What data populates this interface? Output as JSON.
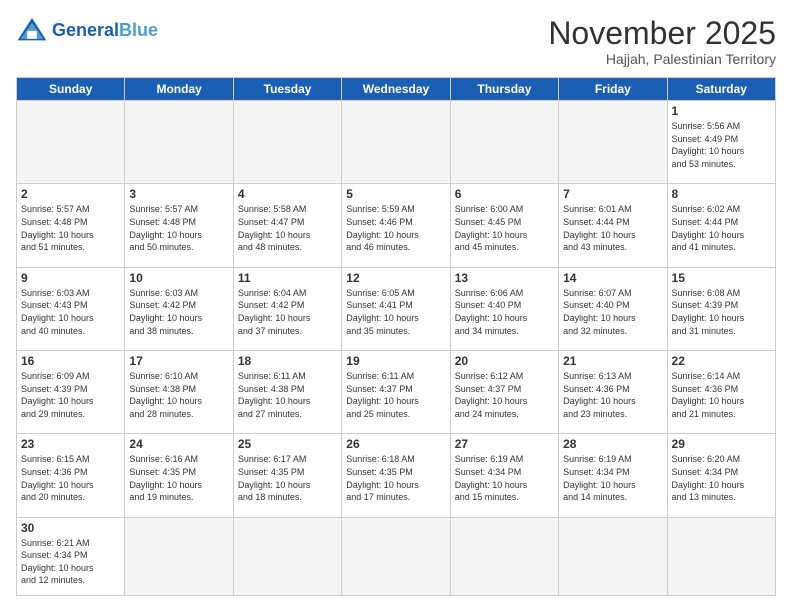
{
  "header": {
    "logo_general": "General",
    "logo_blue": "Blue",
    "month_title": "November 2025",
    "subtitle": "Hajjah, Palestinian Territory"
  },
  "days_of_week": [
    "Sunday",
    "Monday",
    "Tuesday",
    "Wednesday",
    "Thursday",
    "Friday",
    "Saturday"
  ],
  "weeks": [
    [
      {
        "day": "",
        "info": "",
        "empty": true
      },
      {
        "day": "",
        "info": "",
        "empty": true
      },
      {
        "day": "",
        "info": "",
        "empty": true
      },
      {
        "day": "",
        "info": "",
        "empty": true
      },
      {
        "day": "",
        "info": "",
        "empty": true
      },
      {
        "day": "",
        "info": "",
        "empty": true
      },
      {
        "day": "1",
        "info": "Sunrise: 5:56 AM\nSunset: 4:49 PM\nDaylight: 10 hours\nand 53 minutes."
      }
    ],
    [
      {
        "day": "2",
        "info": "Sunrise: 5:57 AM\nSunset: 4:48 PM\nDaylight: 10 hours\nand 51 minutes."
      },
      {
        "day": "3",
        "info": "Sunrise: 5:57 AM\nSunset: 4:48 PM\nDaylight: 10 hours\nand 50 minutes."
      },
      {
        "day": "4",
        "info": "Sunrise: 5:58 AM\nSunset: 4:47 PM\nDaylight: 10 hours\nand 48 minutes."
      },
      {
        "day": "5",
        "info": "Sunrise: 5:59 AM\nSunset: 4:46 PM\nDaylight: 10 hours\nand 46 minutes."
      },
      {
        "day": "6",
        "info": "Sunrise: 6:00 AM\nSunset: 4:45 PM\nDaylight: 10 hours\nand 45 minutes."
      },
      {
        "day": "7",
        "info": "Sunrise: 6:01 AM\nSunset: 4:44 PM\nDaylight: 10 hours\nand 43 minutes."
      },
      {
        "day": "8",
        "info": "Sunrise: 6:02 AM\nSunset: 4:44 PM\nDaylight: 10 hours\nand 41 minutes."
      }
    ],
    [
      {
        "day": "9",
        "info": "Sunrise: 6:03 AM\nSunset: 4:43 PM\nDaylight: 10 hours\nand 40 minutes."
      },
      {
        "day": "10",
        "info": "Sunrise: 6:03 AM\nSunset: 4:42 PM\nDaylight: 10 hours\nand 38 minutes."
      },
      {
        "day": "11",
        "info": "Sunrise: 6:04 AM\nSunset: 4:42 PM\nDaylight: 10 hours\nand 37 minutes."
      },
      {
        "day": "12",
        "info": "Sunrise: 6:05 AM\nSunset: 4:41 PM\nDaylight: 10 hours\nand 35 minutes."
      },
      {
        "day": "13",
        "info": "Sunrise: 6:06 AM\nSunset: 4:40 PM\nDaylight: 10 hours\nand 34 minutes."
      },
      {
        "day": "14",
        "info": "Sunrise: 6:07 AM\nSunset: 4:40 PM\nDaylight: 10 hours\nand 32 minutes."
      },
      {
        "day": "15",
        "info": "Sunrise: 6:08 AM\nSunset: 4:39 PM\nDaylight: 10 hours\nand 31 minutes."
      }
    ],
    [
      {
        "day": "16",
        "info": "Sunrise: 6:09 AM\nSunset: 4:39 PM\nDaylight: 10 hours\nand 29 minutes."
      },
      {
        "day": "17",
        "info": "Sunrise: 6:10 AM\nSunset: 4:38 PM\nDaylight: 10 hours\nand 28 minutes."
      },
      {
        "day": "18",
        "info": "Sunrise: 6:11 AM\nSunset: 4:38 PM\nDaylight: 10 hours\nand 27 minutes."
      },
      {
        "day": "19",
        "info": "Sunrise: 6:11 AM\nSunset: 4:37 PM\nDaylight: 10 hours\nand 25 minutes."
      },
      {
        "day": "20",
        "info": "Sunrise: 6:12 AM\nSunset: 4:37 PM\nDaylight: 10 hours\nand 24 minutes."
      },
      {
        "day": "21",
        "info": "Sunrise: 6:13 AM\nSunset: 4:36 PM\nDaylight: 10 hours\nand 23 minutes."
      },
      {
        "day": "22",
        "info": "Sunrise: 6:14 AM\nSunset: 4:36 PM\nDaylight: 10 hours\nand 21 minutes."
      }
    ],
    [
      {
        "day": "23",
        "info": "Sunrise: 6:15 AM\nSunset: 4:36 PM\nDaylight: 10 hours\nand 20 minutes."
      },
      {
        "day": "24",
        "info": "Sunrise: 6:16 AM\nSunset: 4:35 PM\nDaylight: 10 hours\nand 19 minutes."
      },
      {
        "day": "25",
        "info": "Sunrise: 6:17 AM\nSunset: 4:35 PM\nDaylight: 10 hours\nand 18 minutes."
      },
      {
        "day": "26",
        "info": "Sunrise: 6:18 AM\nSunset: 4:35 PM\nDaylight: 10 hours\nand 17 minutes."
      },
      {
        "day": "27",
        "info": "Sunrise: 6:19 AM\nSunset: 4:34 PM\nDaylight: 10 hours\nand 15 minutes."
      },
      {
        "day": "28",
        "info": "Sunrise: 6:19 AM\nSunset: 4:34 PM\nDaylight: 10 hours\nand 14 minutes."
      },
      {
        "day": "29",
        "info": "Sunrise: 6:20 AM\nSunset: 4:34 PM\nDaylight: 10 hours\nand 13 minutes."
      }
    ],
    [
      {
        "day": "30",
        "info": "Sunrise: 6:21 AM\nSunset: 4:34 PM\nDaylight: 10 hours\nand 12 minutes.",
        "last": true
      },
      {
        "day": "",
        "info": "",
        "empty": true,
        "last": true
      },
      {
        "day": "",
        "info": "",
        "empty": true,
        "last": true
      },
      {
        "day": "",
        "info": "",
        "empty": true,
        "last": true
      },
      {
        "day": "",
        "info": "",
        "empty": true,
        "last": true
      },
      {
        "day": "",
        "info": "",
        "empty": true,
        "last": true
      },
      {
        "day": "",
        "info": "",
        "empty": true,
        "last": true
      }
    ]
  ]
}
